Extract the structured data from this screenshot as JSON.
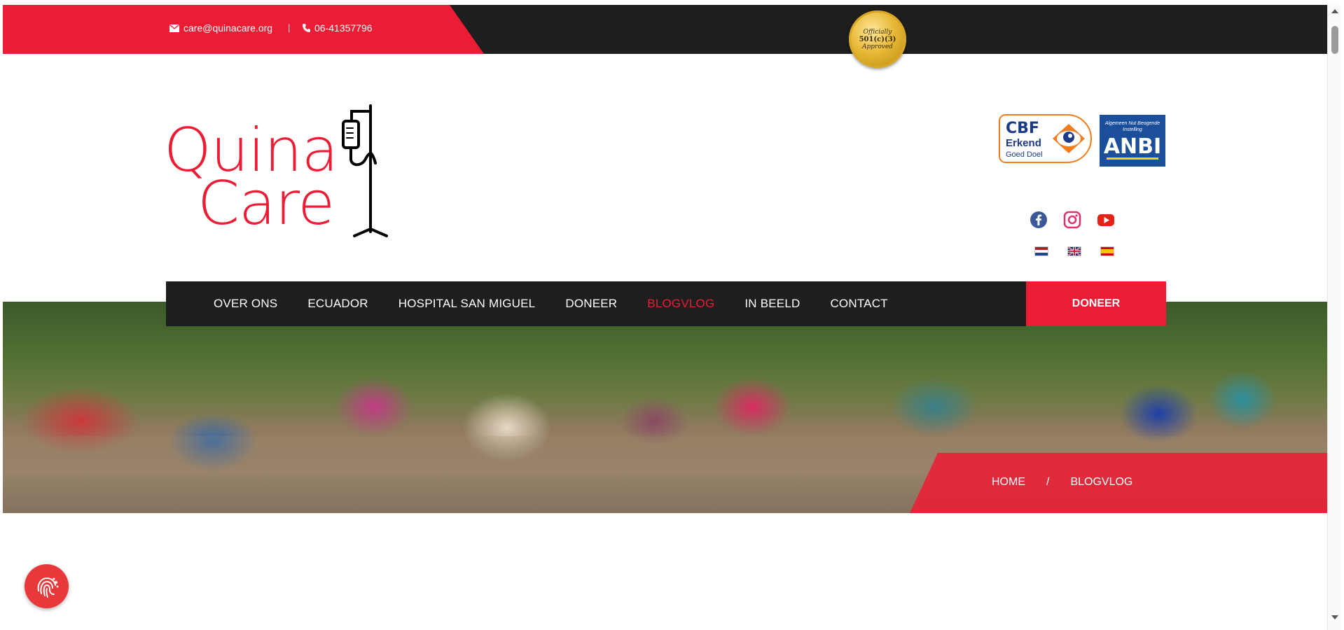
{
  "topbar": {
    "email": "care@quinacare.org",
    "separator": "|",
    "phone": "06-41357796",
    "seal": {
      "line1": "Officially",
      "line2": "501(c)(3)",
      "line3": "Approved"
    }
  },
  "logo": {
    "line1": "Quina",
    "line2": "Care"
  },
  "badges": {
    "cbf": {
      "line1": "CBF",
      "line2": "Erkend",
      "line3": "Goed Doel"
    },
    "anbi": {
      "subtitle": "Algemeen Nut Beogende Instelling",
      "title": "ANBI"
    }
  },
  "social": [
    {
      "icon": "facebook-icon",
      "color": "#3b5998"
    },
    {
      "icon": "instagram-icon",
      "color": "#e1306c"
    },
    {
      "icon": "youtube-icon",
      "color": "#e62117"
    }
  ],
  "languages": [
    "nl",
    "en",
    "es"
  ],
  "nav": {
    "items": [
      {
        "label": "OVER ONS",
        "active": false
      },
      {
        "label": "ECUADOR",
        "active": false
      },
      {
        "label": "HOSPITAL SAN MIGUEL",
        "active": false
      },
      {
        "label": "DONEER",
        "active": false
      },
      {
        "label": "BLOGVLOG",
        "active": true
      },
      {
        "label": "IN BEELD",
        "active": false
      },
      {
        "label": "CONTACT",
        "active": false
      }
    ],
    "donate_label": "DONEER"
  },
  "breadcrumb": {
    "home": "HOME",
    "separator": "/",
    "current": "BLOGVLOG"
  },
  "colors": {
    "brand_red": "#ec1c34",
    "dark": "#1e1e1e"
  }
}
